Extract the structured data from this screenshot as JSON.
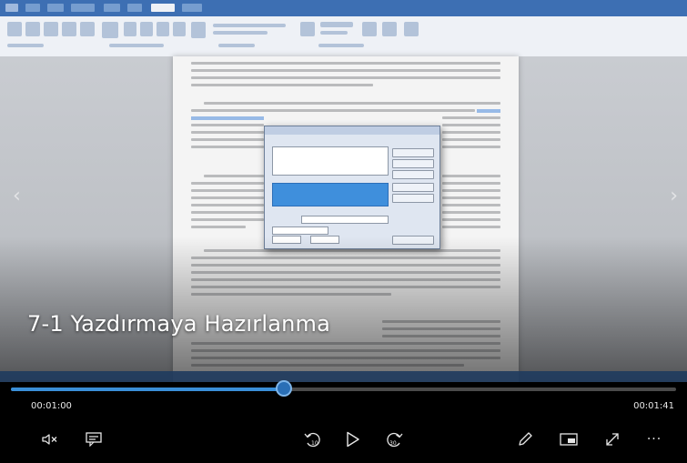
{
  "video": {
    "title": "7-1 Yazdırmaya Hazırlanma",
    "current_time": "00:01:00",
    "total_time": "00:01:41",
    "progress": 0.41
  },
  "controls": {
    "left": [
      {
        "name": "mute-button",
        "icon": "volume-mute-icon"
      },
      {
        "name": "captions-button",
        "icon": "captions-icon"
      }
    ],
    "center": [
      {
        "name": "skip-back-10-button",
        "icon": "skip-back-10-icon",
        "label": "10"
      },
      {
        "name": "play-button",
        "icon": "play-icon"
      },
      {
        "name": "skip-forward-30-button",
        "icon": "skip-forward-30-icon",
        "label": "30"
      }
    ],
    "right": [
      {
        "name": "edit-button",
        "icon": "pencil-icon"
      },
      {
        "name": "mini-view-button",
        "icon": "mini-player-icon"
      },
      {
        "name": "fullscreen-button",
        "icon": "fullscreen-icon"
      },
      {
        "name": "more-button",
        "icon": "more-icon",
        "glyph": "···"
      }
    ]
  },
  "colors": {
    "accent": "#3a8fd8",
    "controls_bg": "#000000",
    "text": "#e8e8e8"
  }
}
